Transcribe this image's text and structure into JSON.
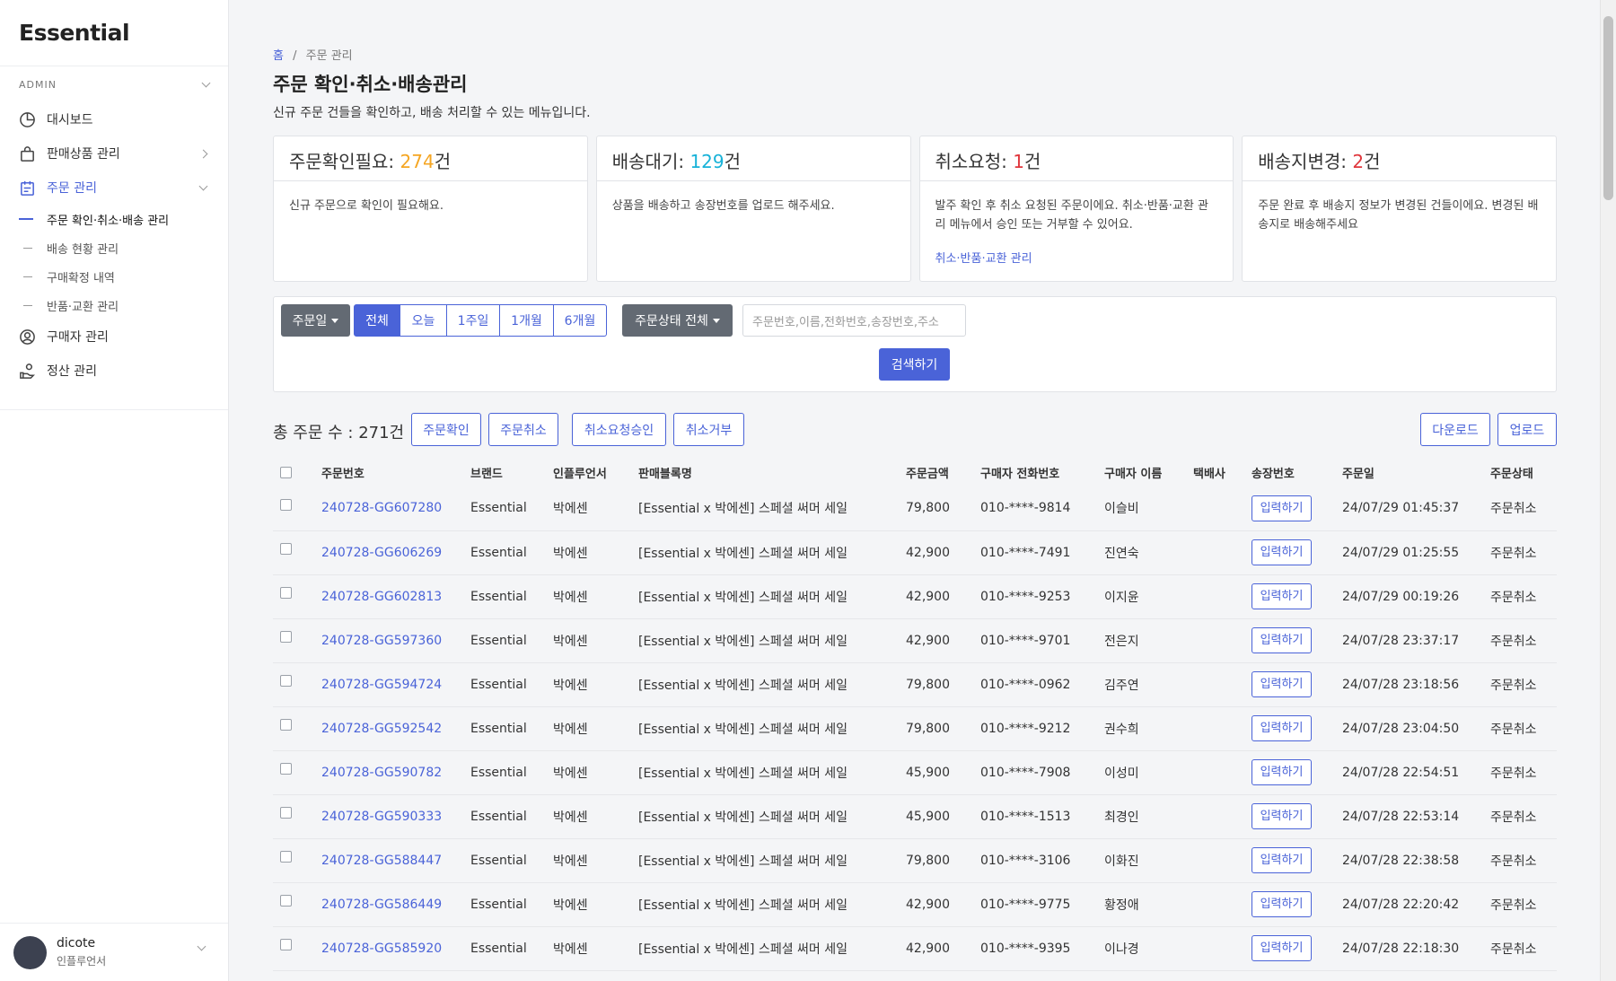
{
  "app": {
    "logo": "Essential"
  },
  "sidebar": {
    "role": "ADMIN",
    "items": [
      {
        "label": "대시보드",
        "icon": "dashboard-icon"
      },
      {
        "label": "판매상품 관리",
        "icon": "shopping-bag-icon"
      },
      {
        "label": "주문 관리",
        "icon": "clipboard-icon"
      },
      {
        "label": "구매자 관리",
        "icon": "user-circle-icon"
      },
      {
        "label": "정산 관리",
        "icon": "hand-coin-icon"
      }
    ],
    "subitems": [
      "주문 확인·취소·배송 관리",
      "배송 현황 관리",
      "구매확정 내역",
      "반품·교환 관리"
    ],
    "user": {
      "name": "dicote",
      "role": "인플루언서"
    }
  },
  "breadcrumb": {
    "home": "홈",
    "sep": "/",
    "current": "주문 관리"
  },
  "page": {
    "title": "주문 확인·취소·배송관리",
    "description": "신규 주문 건들을 확인하고, 배송 처리할 수 있는 메뉴입니다."
  },
  "cards": [
    {
      "label": "주문확인필요: ",
      "count": "274",
      "unit": "건",
      "color": "#f5a623",
      "desc": "신규 주문으로 확인이 필요해요.",
      "link": ""
    },
    {
      "label": "배송대기: ",
      "count": "129",
      "unit": "건",
      "color": "#17b2d8",
      "desc": "상품을 배송하고 송장번호를 업로드 해주세요.",
      "link": ""
    },
    {
      "label": "취소요청: ",
      "count": "1",
      "unit": "건",
      "color": "#e0363c",
      "desc": "발주 확인 후 취소 요청된 주문이에요. 취소·반품·교환 관리 메뉴에서 승인 또는 거부할 수 있어요.",
      "link": "취소·반품·교환 관리"
    },
    {
      "label": "배송지변경: ",
      "count": "2",
      "unit": "건",
      "color": "#e0363c",
      "desc": "주문 완료 후 배송지 정보가 변경된 건들이에요. 변경된 배송지로 배송해주세요",
      "link": ""
    }
  ],
  "filter": {
    "date_dropdown": "주문일",
    "periods": [
      "전체",
      "오늘",
      "1주일",
      "1개월",
      "6개월"
    ],
    "selected_period": "전체",
    "status_dropdown": "주문상태 전체",
    "search_placeholder": "주문번호,이름,전화번호,송장번호,주소",
    "search_button": "검색하기"
  },
  "list": {
    "total_label": "총 주문 수 : 271건",
    "actions": [
      "주문확인",
      "주문취소",
      "취소요청승인",
      "취소거부"
    ],
    "download": "다운로드",
    "upload": "업로드"
  },
  "table": {
    "columns": [
      "주문번호",
      "브랜드",
      "인플루언서",
      "판매블록명",
      "주문금액",
      "구매자 전화번호",
      "구매자 이름",
      "택배사",
      "송장번호",
      "주문일",
      "주문상태"
    ],
    "input_button": "입력하기",
    "rows": [
      {
        "order_no": "240728-GG607280",
        "brand": "Essential",
        "influencer": "박에센",
        "block": "[Essential x 박에센] 스페셜 써머 세일",
        "amount": "79,800",
        "phone": "010-****-9814",
        "buyer": "이슬비",
        "courier": "",
        "date": "24/07/29 01:45:37",
        "status": "주문취소"
      },
      {
        "order_no": "240728-GG606269",
        "brand": "Essential",
        "influencer": "박에센",
        "block": "[Essential x 박에센] 스페셜 써머 세일",
        "amount": "42,900",
        "phone": "010-****-7491",
        "buyer": "진연숙",
        "courier": "",
        "date": "24/07/29 01:25:55",
        "status": "주문취소"
      },
      {
        "order_no": "240728-GG602813",
        "brand": "Essential",
        "influencer": "박에센",
        "block": "[Essential x 박에센] 스페셜 써머 세일",
        "amount": "42,900",
        "phone": "010-****-9253",
        "buyer": "이지윤",
        "courier": "",
        "date": "24/07/29 00:19:26",
        "status": "주문취소"
      },
      {
        "order_no": "240728-GG597360",
        "brand": "Essential",
        "influencer": "박에센",
        "block": "[Essential x 박에센] 스페셜 써머 세일",
        "amount": "42,900",
        "phone": "010-****-9701",
        "buyer": "전은지",
        "courier": "",
        "date": "24/07/28 23:37:17",
        "status": "주문취소"
      },
      {
        "order_no": "240728-GG594724",
        "brand": "Essential",
        "influencer": "박에센",
        "block": "[Essential x 박에센] 스페셜 써머 세일",
        "amount": "79,800",
        "phone": "010-****-0962",
        "buyer": "김주연",
        "courier": "",
        "date": "24/07/28 23:18:56",
        "status": "주문취소"
      },
      {
        "order_no": "240728-GG592542",
        "brand": "Essential",
        "influencer": "박에센",
        "block": "[Essential x 박에센] 스페셜 써머 세일",
        "amount": "79,800",
        "phone": "010-****-9212",
        "buyer": "권수희",
        "courier": "",
        "date": "24/07/28 23:04:50",
        "status": "주문취소"
      },
      {
        "order_no": "240728-GG590782",
        "brand": "Essential",
        "influencer": "박에센",
        "block": "[Essential x 박에센] 스페셜 써머 세일",
        "amount": "45,900",
        "phone": "010-****-7908",
        "buyer": "이성미",
        "courier": "",
        "date": "24/07/28 22:54:51",
        "status": "주문취소"
      },
      {
        "order_no": "240728-GG590333",
        "brand": "Essential",
        "influencer": "박에센",
        "block": "[Essential x 박에센] 스페셜 써머 세일",
        "amount": "45,900",
        "phone": "010-****-1513",
        "buyer": "최경인",
        "courier": "",
        "date": "24/07/28 22:53:14",
        "status": "주문취소"
      },
      {
        "order_no": "240728-GG588447",
        "brand": "Essential",
        "influencer": "박에센",
        "block": "[Essential x 박에센] 스페셜 써머 세일",
        "amount": "79,800",
        "phone": "010-****-3106",
        "buyer": "이화진",
        "courier": "",
        "date": "24/07/28 22:38:58",
        "status": "주문취소"
      },
      {
        "order_no": "240728-GG586449",
        "brand": "Essential",
        "influencer": "박에센",
        "block": "[Essential x 박에센] 스페셜 써머 세일",
        "amount": "42,900",
        "phone": "010-****-9775",
        "buyer": "황정애",
        "courier": "",
        "date": "24/07/28 22:20:42",
        "status": "주문취소"
      },
      {
        "order_no": "240728-GG585920",
        "brand": "Essential",
        "influencer": "박에센",
        "block": "[Essential x 박에센] 스페셜 써머 세일",
        "amount": "42,900",
        "phone": "010-****-9395",
        "buyer": "이나경",
        "courier": "",
        "date": "24/07/28 22:18:30",
        "status": "주문취소"
      }
    ]
  }
}
